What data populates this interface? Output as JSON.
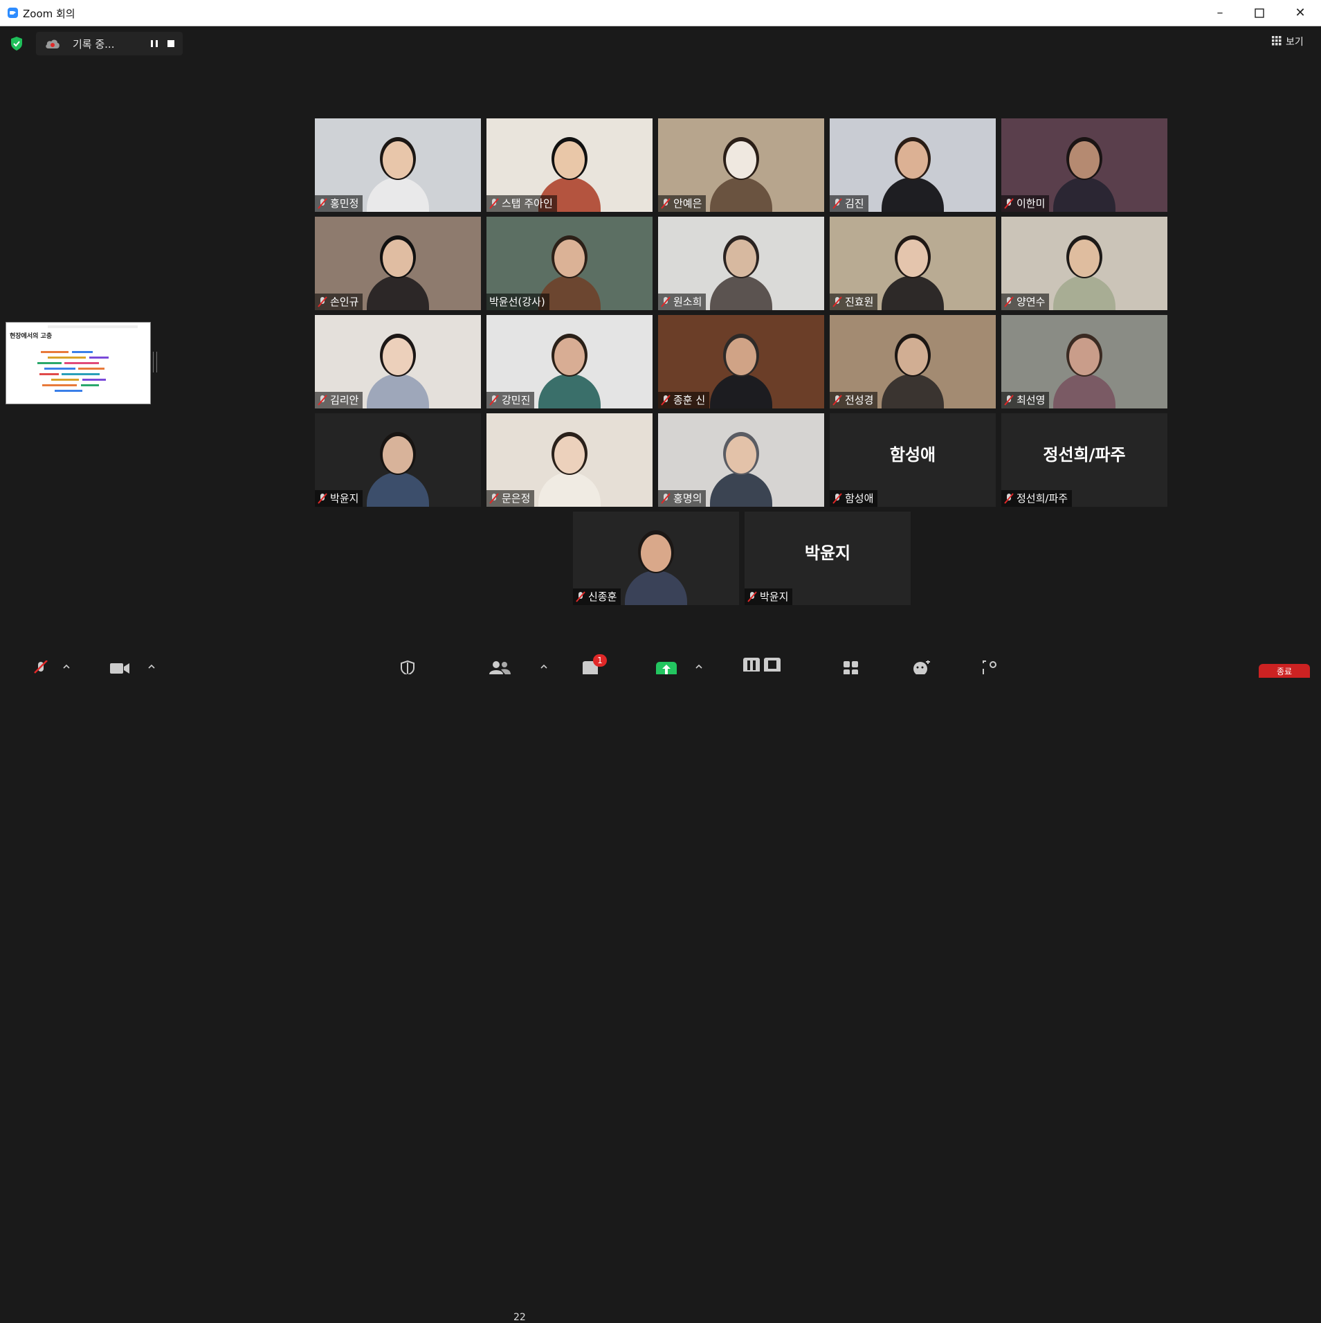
{
  "window": {
    "title": "Zoom 회의"
  },
  "topbar": {
    "recording_label": "기록 중...",
    "view_label": "보기"
  },
  "share_thumbnail": {
    "title": "현장에서의 고충"
  },
  "participants": [
    {
      "name": "홍민정",
      "muted": true,
      "video": true,
      "bg": "#cfd2d6",
      "skin": "#e8c6aa",
      "hair": "#1c1714",
      "shirt": "#e9e9ea"
    },
    {
      "name": "스탭 주아인",
      "muted": true,
      "video": true,
      "bg": "#e9e4dc",
      "skin": "#e9c7a8",
      "hair": "#111111",
      "shirt": "#b4543f"
    },
    {
      "name": "안예은",
      "muted": true,
      "video": true,
      "bg": "#b7a58d",
      "skin": "#efe8e0",
      "hair": "#2a1e17",
      "shirt": "#6a5340"
    },
    {
      "name": "김진",
      "muted": true,
      "video": true,
      "bg": "#c9ccd3",
      "skin": "#dcb194",
      "hair": "#2a1d16",
      "shirt": "#1e1e22"
    },
    {
      "name": "이한미",
      "muted": true,
      "video": true,
      "bg": "#5a3f4c",
      "skin": "#b58a71",
      "hair": "#1a1414",
      "shirt": "#2b2633"
    },
    {
      "name": "손인규",
      "muted": true,
      "video": true,
      "bg": "#8e7b6e",
      "skin": "#e0bda2",
      "hair": "#111111",
      "shirt": "#2c2727"
    },
    {
      "name": "박윤선(강사)",
      "muted": false,
      "video": true,
      "active": true,
      "bg": "#5c6f63",
      "skin": "#dbb296",
      "hair": "#2c2018",
      "shirt": "#6c4630"
    },
    {
      "name": "원소희",
      "muted": true,
      "video": true,
      "bg": "#dadad8",
      "skin": "#d7b9a0",
      "hair": "#2a2321",
      "shirt": "#5b5350"
    },
    {
      "name": "진효원",
      "muted": true,
      "video": true,
      "bg": "#b9ab93",
      "skin": "#e4c5ad",
      "hair": "#1f1815",
      "shirt": "#2d2928"
    },
    {
      "name": "양연수",
      "muted": true,
      "video": true,
      "bg": "#cbc4b8",
      "skin": "#dfbd9f",
      "hair": "#1d1a18",
      "shirt": "#a8ad94"
    },
    {
      "name": "김리안",
      "muted": true,
      "video": true,
      "bg": "#e4e0db",
      "skin": "#ecd0bb",
      "hair": "#1c1716",
      "shirt": "#9ea7ba"
    },
    {
      "name": "강민진",
      "muted": true,
      "video": true,
      "bg": "#e4e4e4",
      "skin": "#d8ad94",
      "hair": "#2a2018",
      "shirt": "#3a6f6a"
    },
    {
      "name": "종훈 신",
      "muted": true,
      "video": true,
      "bg": "#6b3e28",
      "skin": "#d0a386",
      "hair": "#2e2a28",
      "shirt": "#1c1c20"
    },
    {
      "name": "전성경",
      "muted": true,
      "video": true,
      "bg": "#a38b72",
      "skin": "#d1ae93",
      "hair": "#1b1613",
      "shirt": "#3a3430"
    },
    {
      "name": "최선영",
      "muted": true,
      "video": true,
      "bg": "#8a8c85",
      "skin": "#c99d8a",
      "hair": "#3a2a22",
      "shirt": "#7a5a64"
    },
    {
      "name": "박윤지",
      "muted": true,
      "video": true,
      "bg": "#242424",
      "skin": "#d8b39a",
      "hair": "#171412",
      "shirt": "#3c4e6b"
    },
    {
      "name": "문은정",
      "muted": true,
      "video": true,
      "bg": "#e6dfd6",
      "skin": "#ecd1bc",
      "hair": "#2a211b",
      "shirt": "#f0ebe3"
    },
    {
      "name": "홍명의",
      "muted": true,
      "video": true,
      "bg": "#d6d4d2",
      "skin": "#e3c2a9",
      "hair": "#5a5c63",
      "shirt": "#3b4452"
    },
    {
      "name": "함성애",
      "muted": true,
      "video": false
    },
    {
      "name": "정선희/파주",
      "muted": true,
      "video": false
    },
    {
      "name": "신종훈",
      "muted": true,
      "video": true,
      "bg": "#252525",
      "skin": "#d9a88a",
      "hair": "#1b1715",
      "shirt": "#3a4258"
    },
    {
      "name": "박윤지",
      "muted": true,
      "video": false
    }
  ],
  "toolbar": {
    "participant_count": "22",
    "chat_badge": "1",
    "end_label": "종료"
  },
  "colors": {
    "accent": "#2d8cff",
    "active_border": "#f0e46b",
    "mute_red": "#e02828",
    "share_green": "#23c560"
  }
}
